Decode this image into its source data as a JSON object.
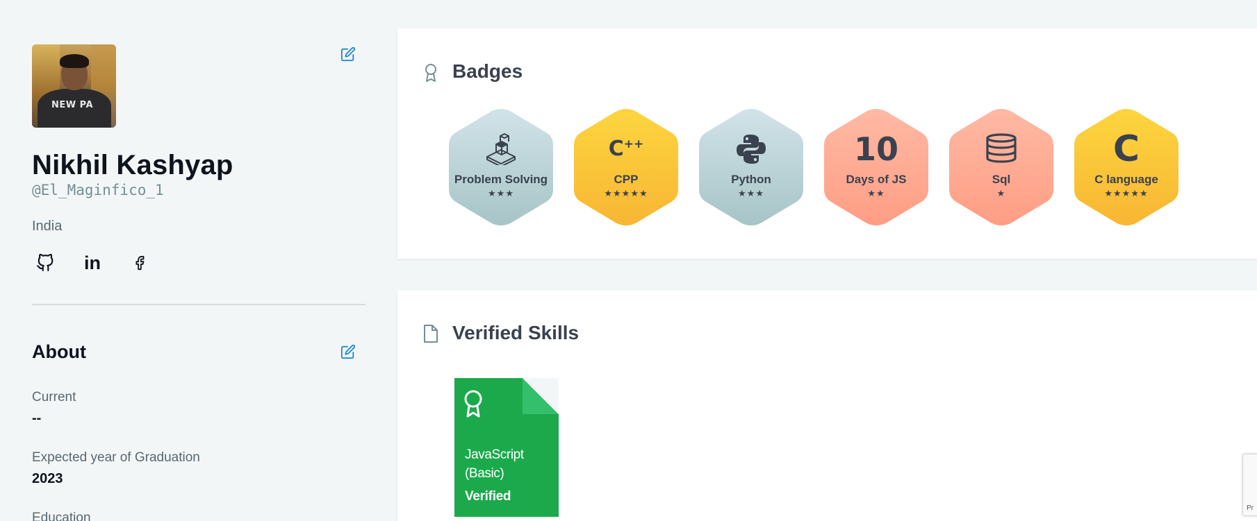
{
  "profile": {
    "name": "Nikhil Kashyap",
    "handle": "@El_Maginfico_1",
    "country": "India",
    "avatar_text": "NEW PA"
  },
  "socials": [
    "github-icon",
    "linkedin-icon",
    "facebook-icon"
  ],
  "socials_labels": {
    "linkedin": "in"
  },
  "about": {
    "title": "About",
    "fields": [
      {
        "label": "Current",
        "value": "--"
      },
      {
        "label": "Expected year of Graduation",
        "value": "2023"
      },
      {
        "label": "Education",
        "value": ""
      }
    ]
  },
  "badges_section": {
    "title": "Badges",
    "items": [
      {
        "label": "Problem Solving",
        "stars": "★★★",
        "glyph": "",
        "icon": "problem-solving-icon",
        "color": "#c4dadf"
      },
      {
        "label": "CPP",
        "stars": "★★★★★",
        "glyph": "C++",
        "icon": "cpp-icon",
        "color": "#fbc93d"
      },
      {
        "label": "Python",
        "stars": "★★★",
        "glyph": "",
        "icon": "python-icon",
        "color": "#c4dadf"
      },
      {
        "label": "Days of JS",
        "stars": "★★",
        "glyph": "10",
        "icon": "days-of-js-icon",
        "color": "#ffad97"
      },
      {
        "label": "Sql",
        "stars": "★",
        "glyph": "",
        "icon": "database-icon",
        "color": "#ffad97"
      },
      {
        "label": "C language",
        "stars": "★★★★★",
        "glyph": "C",
        "icon": "c-language-icon",
        "color": "#fbc93d"
      }
    ]
  },
  "skills_section": {
    "title": "Verified Skills",
    "items": [
      {
        "name": "JavaScript (Basic)",
        "status": "Verified",
        "color": "#1ba94c"
      }
    ]
  },
  "recaptcha": {
    "text": "Pr"
  },
  "colors": {
    "background": "#f3f6f7",
    "card": "#ffffff",
    "edit_icon": "#1f8acb",
    "heading": "#0e141e",
    "muted": "#576871"
  }
}
